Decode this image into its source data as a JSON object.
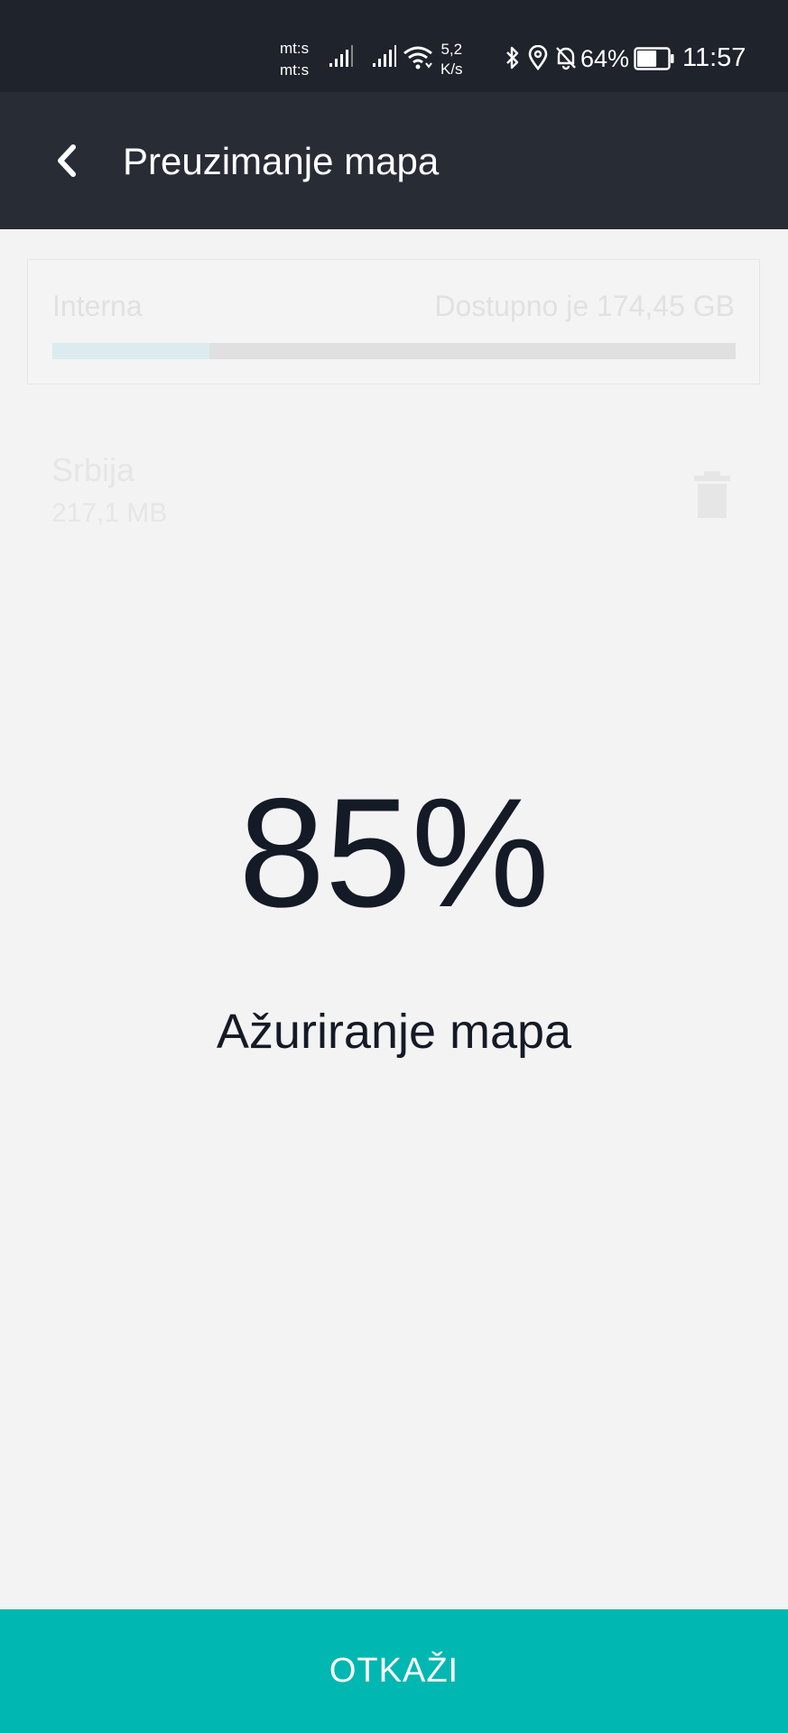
{
  "status_bar": {
    "carrier_1": "mt:s",
    "carrier_2": "mt:s",
    "speed_value": "5,2",
    "speed_unit": "K/s",
    "battery_percent": "64%",
    "battery_level": 64,
    "time": "11:57",
    "icons": [
      "signal-icon",
      "signal-icon",
      "wifi-icon",
      "bluetooth-icon",
      "location-icon",
      "bell-off-icon",
      "battery-icon"
    ]
  },
  "header": {
    "title": "Preuzimanje mapa",
    "back_icon": "chevron-left-icon"
  },
  "storage": {
    "label": "Interna",
    "available": "Dostupno je 174,45 GB",
    "used_fraction": 0.23
  },
  "map_item": {
    "name": "Srbija",
    "size": "217,1 MB",
    "delete_icon": "trash-icon"
  },
  "progress": {
    "percent": "85%",
    "label": "Ažuriranje mapa"
  },
  "actions": {
    "cancel_label": "OTKAŽI"
  },
  "colors": {
    "status_bar": "#1f232b",
    "header": "#282c35",
    "background": "#f3f3f3",
    "accent": "#01b7b1",
    "text_dark": "#141a26"
  }
}
